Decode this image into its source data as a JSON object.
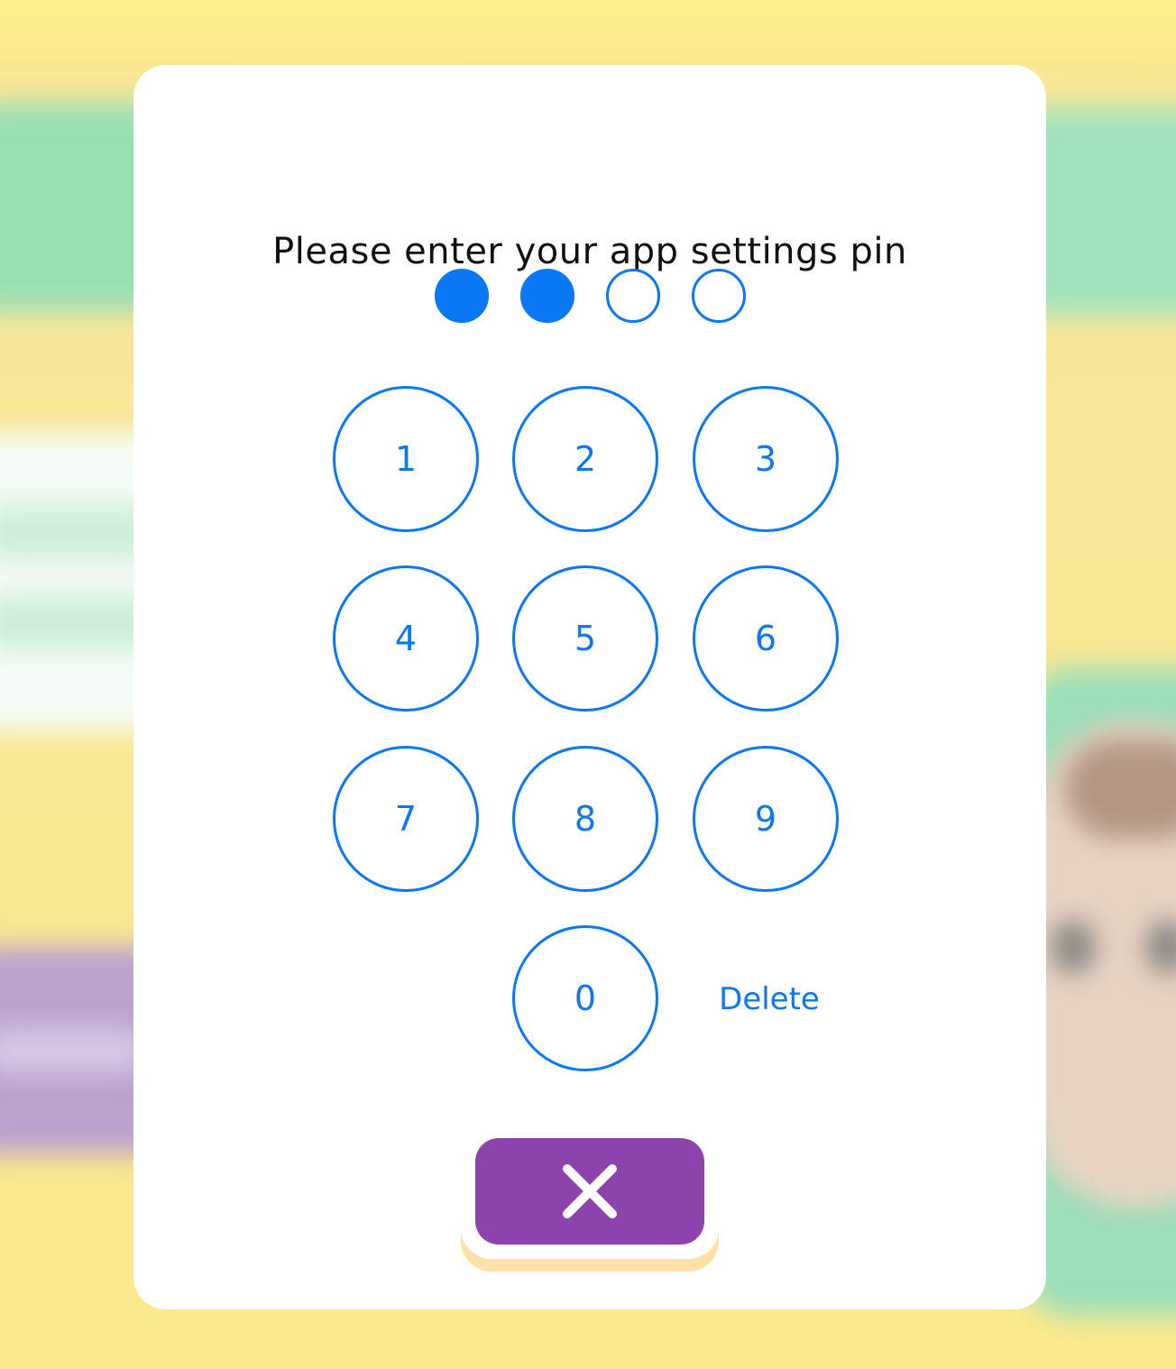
{
  "dialog": {
    "title": "Please enter your app settings pin"
  },
  "pin": {
    "length": 4,
    "entered": 2
  },
  "keypad": {
    "keys": [
      "1",
      "2",
      "3",
      "4",
      "5",
      "6",
      "7",
      "8",
      "9",
      "0"
    ],
    "delete_label": "Delete"
  },
  "close": {
    "icon": "close-icon"
  },
  "colors": {
    "accent": "#0a78f5",
    "close_button": "#8c44ac",
    "close_shadow": "#ffe0a7",
    "backdrop": "#fbe88a"
  }
}
